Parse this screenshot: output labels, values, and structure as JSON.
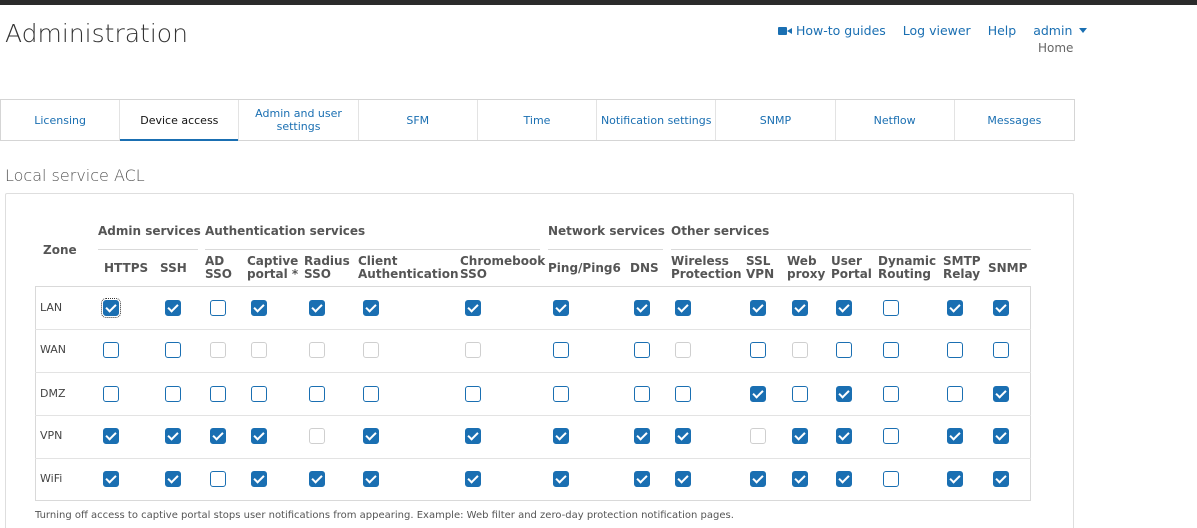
{
  "header": {
    "title": "Administration",
    "links": {
      "howto": "How-to guides",
      "log": "Log viewer",
      "help": "Help",
      "user": "admin"
    },
    "breadcrumb": "Home"
  },
  "tabs": [
    "Licensing",
    "Device access",
    "Admin and user settings",
    "SFM",
    "Time",
    "Notification settings",
    "SNMP",
    "Netflow",
    "Messages"
  ],
  "section_title": "Local service ACL",
  "acl": {
    "zone_header": "Zone",
    "groups": [
      "Admin services",
      "Authentication services",
      "Network services",
      "Other services"
    ],
    "columns": [
      [
        "HTTPS"
      ],
      [
        "SSH"
      ],
      [
        "AD",
        "SSO"
      ],
      [
        "Captive",
        "portal *"
      ],
      [
        "Radius",
        "SSO"
      ],
      [
        "Client",
        "Authentication"
      ],
      [
        "Chromebook",
        "SSO"
      ],
      [
        "Ping/Ping6"
      ],
      [
        "DNS"
      ],
      [
        "Wireless",
        "Protection"
      ],
      [
        "SSL",
        "VPN"
      ],
      [
        "Web",
        "proxy"
      ],
      [
        "User",
        "Portal"
      ],
      [
        "Dynamic",
        "Routing"
      ],
      [
        "SMTP",
        "Relay"
      ],
      [
        "SNMP"
      ]
    ],
    "rows": [
      {
        "zone": "LAN",
        "states": [
          1,
          1,
          0,
          1,
          1,
          1,
          1,
          1,
          1,
          1,
          1,
          1,
          1,
          0,
          1,
          1
        ]
      },
      {
        "zone": "WAN",
        "states": [
          0,
          0,
          2,
          2,
          2,
          2,
          2,
          0,
          0,
          2,
          0,
          2,
          0,
          0,
          0,
          0
        ]
      },
      {
        "zone": "DMZ",
        "states": [
          0,
          0,
          0,
          0,
          0,
          0,
          0,
          0,
          0,
          0,
          1,
          0,
          1,
          0,
          0,
          1
        ]
      },
      {
        "zone": "VPN",
        "states": [
          1,
          1,
          1,
          1,
          2,
          1,
          1,
          1,
          1,
          1,
          2,
          1,
          1,
          0,
          1,
          1
        ]
      },
      {
        "zone": "WiFi",
        "states": [
          1,
          1,
          0,
          1,
          1,
          1,
          1,
          1,
          1,
          1,
          1,
          1,
          1,
          0,
          1,
          1
        ]
      }
    ],
    "footnote": "Turning off access to captive portal stops user notifications from appearing. Example: Web filter and zero-day protection notification pages."
  }
}
